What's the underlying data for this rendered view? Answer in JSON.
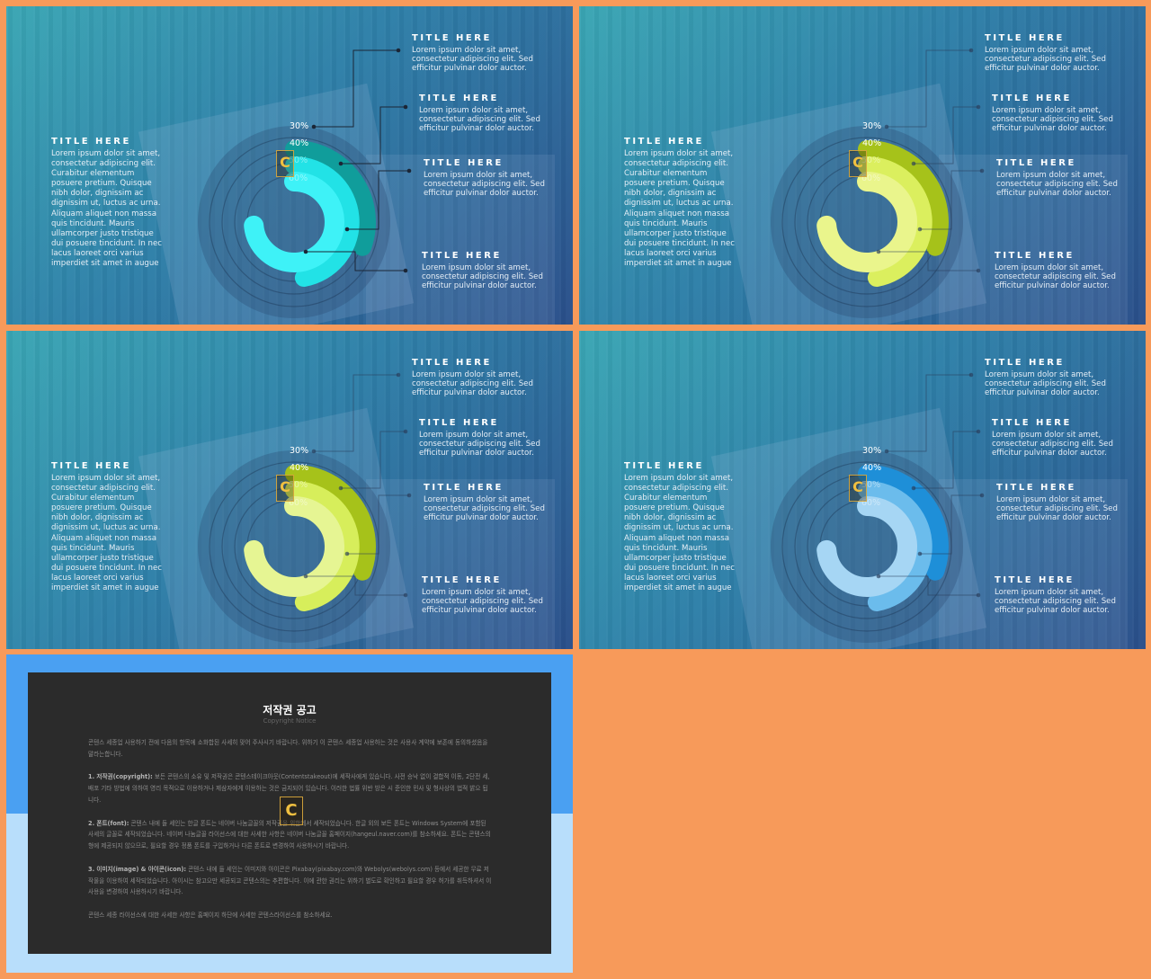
{
  "slides": [
    {
      "left": {
        "title": "TITLE HERE",
        "body": "Lorem ipsum dolor sit amet, consectetur adipiscing elit. Curabitur elementum posuere pretium. Quisque nibh dolor, dignissim ac dignissim ut, luctus ac urna. Aliquam aliquet non massa quis tincidunt. Mauris ullamcorper justo tristique dui posuere tincidunt. In nec lacus laoreet orci varius imperdiet sit amet in augue"
      },
      "callouts": [
        {
          "title": "TITLE HERE",
          "body": "Lorem ipsum dolor sit amet, consectetur adipiscing elit. Sed efficitur pulvinar dolor auctor."
        },
        {
          "title": "TITLE HERE",
          "body": "Lorem ipsum dolor sit amet, consectetur adipiscing elit. Sed efficitur pulvinar dolor auctor."
        },
        {
          "title": "TITLE HERE",
          "body": "Lorem ipsum dolor sit amet, consectetur adipiscing elit. Sed efficitur pulvinar dolor auctor."
        },
        {
          "title": "TITLE HERE",
          "body": "Lorem ipsum dolor sit amet, consectetur adipiscing elit. Sed efficitur pulvinar dolor auctor."
        }
      ],
      "labels": [
        "30%",
        "40%",
        "50%",
        "60%"
      ],
      "colors": [
        "#109d9b",
        "#22e2e6",
        "#3ef2f7"
      ],
      "active_lines": true
    },
    {
      "left": {
        "title": "TITLE HERE",
        "body": "Lorem ipsum dolor sit amet, consectetur adipiscing elit. Curabitur elementum posuere pretium. Quisque nibh dolor, dignissim ac dignissim ut, luctus ac urna. Aliquam aliquet non massa quis tincidunt. Mauris ullamcorper justo tristique dui posuere tincidunt. In nec lacus laoreet orci varius imperdiet sit amet in augue"
      },
      "callouts": [
        {
          "title": "TITLE HERE",
          "body": "Lorem ipsum dolor sit amet, consectetur adipiscing elit. Sed efficitur pulvinar dolor auctor."
        },
        {
          "title": "TITLE HERE",
          "body": "Lorem ipsum dolor sit amet, consectetur adipiscing elit. Sed efficitur pulvinar dolor auctor."
        },
        {
          "title": "TITLE HERE",
          "body": "Lorem ipsum dolor sit amet, consectetur adipiscing elit. Sed efficitur pulvinar dolor auctor."
        },
        {
          "title": "TITLE HERE",
          "body": "Lorem ipsum dolor sit amet, consectetur adipiscing elit. Sed efficitur pulvinar dolor auctor."
        }
      ],
      "labels": [
        "30%",
        "40%",
        "50%",
        "60%"
      ],
      "colors": [
        "#a6c21a",
        "#dbef5e",
        "#eaf58c"
      ],
      "active_lines": false
    },
    {
      "left": {
        "title": "TITLE HERE",
        "body": "Lorem ipsum dolor sit amet, consectetur adipiscing elit. Curabitur elementum posuere pretium. Quisque nibh dolor, dignissim ac dignissim ut, luctus ac urna. Aliquam aliquet non massa quis tincidunt. Mauris ullamcorper justo tristique dui posuere tincidunt. In nec lacus laoreet orci varius imperdiet sit amet in augue"
      },
      "callouts": [
        {
          "title": "TITLE HERE",
          "body": "Lorem ipsum dolor sit amet, consectetur adipiscing elit. Sed efficitur pulvinar dolor auctor."
        },
        {
          "title": "TITLE HERE",
          "body": "Lorem ipsum dolor sit amet, consectetur adipiscing elit. Sed efficitur pulvinar dolor auctor."
        },
        {
          "title": "TITLE HERE",
          "body": "Lorem ipsum dolor sit amet, consectetur adipiscing elit. Sed efficitur pulvinar dolor auctor."
        },
        {
          "title": "TITLE HERE",
          "body": "Lorem ipsum dolor sit amet, consectetur adipiscing elit. Sed efficitur pulvinar dolor auctor."
        }
      ],
      "labels": [
        "30%",
        "40%",
        "50%",
        "60%"
      ],
      "colors": [
        "#a6c21a",
        "#d7ee5b",
        "#e6f593"
      ],
      "active_lines": false
    },
    {
      "left": {
        "title": "TITLE HERE",
        "body": "Lorem ipsum dolor sit amet, consectetur adipiscing elit. Curabitur elementum posuere pretium. Quisque nibh dolor, dignissim ac dignissim ut, luctus ac urna. Aliquam aliquet non massa quis tincidunt. Mauris ullamcorper justo tristique dui posuere tincidunt. In nec lacus laoreet orci varius imperdiet sit amet in augue"
      },
      "callouts": [
        {
          "title": "TITLE HERE",
          "body": "Lorem ipsum dolor sit amet, consectetur adipiscing elit. Sed efficitur pulvinar dolor auctor."
        },
        {
          "title": "TITLE HERE",
          "body": "Lorem ipsum dolor sit amet, consectetur adipiscing elit. Sed efficitur pulvinar dolor auctor."
        },
        {
          "title": "TITLE HERE",
          "body": "Lorem ipsum dolor sit amet, consectetur adipiscing elit. Sed efficitur pulvinar dolor auctor."
        },
        {
          "title": "TITLE HERE",
          "body": "Lorem ipsum dolor sit amet, consectetur adipiscing elit. Sed efficitur pulvinar dolor auctor."
        }
      ],
      "labels": [
        "30%",
        "40%",
        "50%",
        "60%"
      ],
      "colors": [
        "#1e8fd8",
        "#6bbcec",
        "#a6d6f4"
      ],
      "active_lines": false
    }
  ],
  "chart_data": {
    "type": "pie",
    "categories": [
      "30%",
      "40%",
      "50%",
      "60%"
    ],
    "values": [
      30,
      40,
      50,
      60
    ],
    "title": ""
  },
  "logo_letter": "C",
  "copyright": {
    "title": "저작권 공고",
    "subtitle": "Copyright Notice",
    "paragraphs": [
      {
        "bold": "",
        "text": "콘텐스 세종업 사용하기 전에 다음의 항목에 소화합된 사세히 맞어 주사시기 바랍니다. 위하기 이 콘텐스 세종업 사용하는 것은 사용사 계약에 보존에 동의하셨음을 말라는합니다."
      },
      {
        "bold": "1. 저작권(copyright):",
        "text": " 보든 콘텐스의 소유 및 저작권은 콘텐스테이크아웃(Contentstakeout)에 세작사에게 있습니다. 사전 승낙 없이 결합적 이동, 2단전 세, 배포 기타 방법에 의하여 영리 목적으로 이용하거나 제삼자에게 이용하는 것은 금지되어 있습니다. 이러한 법률 위반 방은 시 준인한 민사 및 형사상의 법적 밝으 됩니다."
      },
      {
        "bold": "2. 폰트(font):",
        "text": " 콘텐스 내에 들 세인는 한글 폰트는 네이버 나눔글꼴의 저작권을 위한데서 세작되었습니다. 한글 외의 보든 폰트는 Windows System에 포함된 사세의 글꼴로 세작되었습니다. 네이버 나눔글꼴 라이선스에 대한 사세한 사항은 네이버 나눔글꼴 홈페이지(hangeul.naver.com)를 참소하세요. 폰트는 콘텐스의 형에 제공되지 않으므로, 필요할 경우 정품 폰트를 구입하거나 다른 폰트로 변경하여 사용하시기 바랍니다."
      },
      {
        "bold": "3. 이미지(image) & 아이콘(icon):",
        "text": " 콘텐스 내에 들 세인는 이미지와 아이콘은 Pixabay(pixabay.com)와 Webolys(webolys.com) 등에서 세공한 무료 저작물을 이용하여 세작되었습니다. 아이시는 참고으만 세공되고 콘텐스의는 추편합니다. 이에 관한 권리는 위하기 별도로 확인하고 필요할 경우 허가를 취득하셔서 이사용을 변경하여 사용하시기 바랍니다."
      },
      {
        "bold": "",
        "text": "콘텐스 세종 라이선스에 대한 사세한 사항은 홈페이지 하단에 사세한 콘텐스라이선스를 참소하세요."
      }
    ]
  }
}
